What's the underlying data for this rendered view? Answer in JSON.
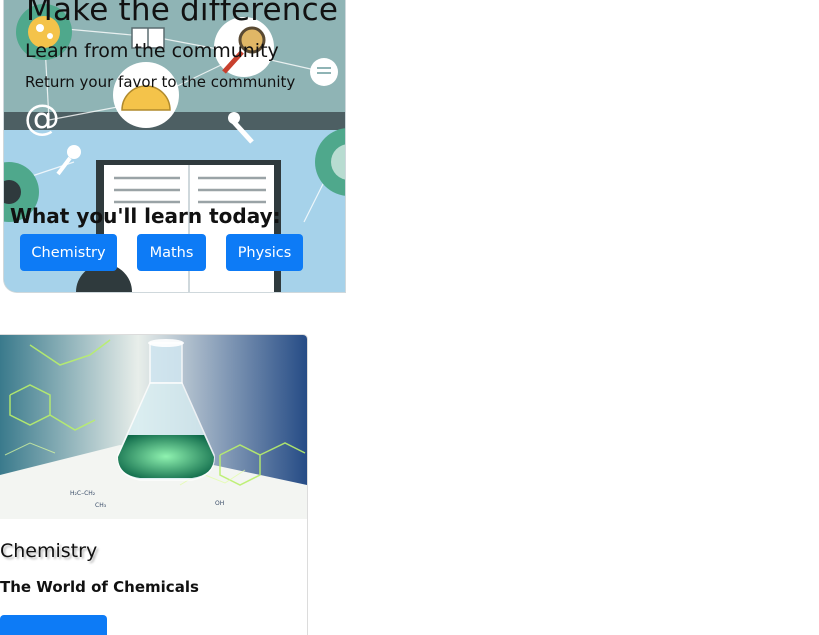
{
  "hero": {
    "title": "Make the difference",
    "subtitle": "Learn from the community",
    "tagline": "Return your favor to the community",
    "learn_label": "What you'll learn today:",
    "subjects": [
      {
        "label": "Chemistry"
      },
      {
        "label": "Maths"
      },
      {
        "label": "Physics"
      }
    ]
  },
  "card": {
    "title": "Chemistry",
    "text": "The World of Chemicals",
    "button_label": ""
  },
  "colors": {
    "primary_button": "#0d7bf6",
    "hero_background": "#8fb4b5"
  },
  "icons": [
    "atom-icon",
    "book-icon",
    "magnifier-icon",
    "protractor-icon",
    "chat-bubble-icon",
    "at-sign-icon",
    "wrench-icon",
    "key-icon",
    "open-book-icon",
    "flask-icon"
  ]
}
